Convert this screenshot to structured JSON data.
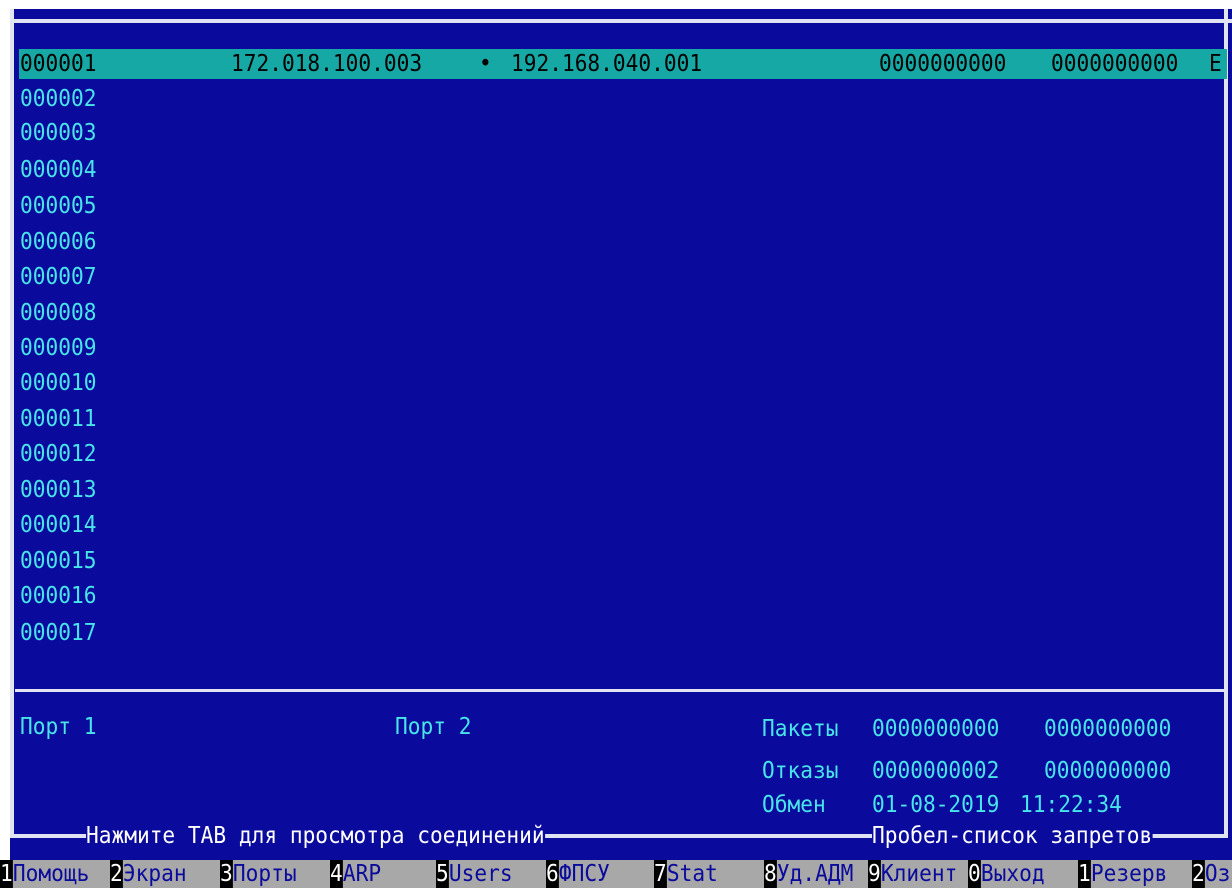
{
  "selected_row": {
    "id": "000001",
    "src_ip": "172.018.100.003",
    "arrow": "•",
    "dst_ip": "192.168.040.001",
    "count1": "0000000000",
    "count2": "0000000000",
    "flag": "E"
  },
  "rows": [
    "000002",
    "000003",
    "000004",
    "000005",
    "000006",
    "000007",
    "000008",
    "000009",
    "000010",
    "000011",
    "000012",
    "000013",
    "000014",
    "000015",
    "000016",
    "000017"
  ],
  "status": {
    "port1_label": "Порт 1",
    "port2_label": "Порт 2",
    "packets_label": "Пакеты",
    "packets_1": "0000000000",
    "packets_2": "0000000000",
    "failures_label": "Отказы",
    "failures_1": "0000000002",
    "failures_2": "0000000000",
    "exchange_label": "Обмен",
    "exchange_date": "01-08-2019",
    "exchange_time": "11:22:34"
  },
  "hints": {
    "left": "Нажмите TAB для просмотра соединений",
    "right": "Пробел-список запретов"
  },
  "fkeys": [
    {
      "num": "1",
      "label": "Помощь"
    },
    {
      "num": "2",
      "label": "Экран"
    },
    {
      "num": "3",
      "label": "Порты"
    },
    {
      "num": "4",
      "label": "ARP"
    },
    {
      "num": "5",
      "label": "Users"
    },
    {
      "num": "6",
      "label": "ФПСУ"
    },
    {
      "num": "7",
      "label": "Stat"
    },
    {
      "num": "8",
      "label": "Уд.АДМ"
    },
    {
      "num": "9",
      "label": "Клиент"
    },
    {
      "num": "0",
      "label": "Выход"
    },
    {
      "num": "1",
      "label": "Резерв"
    },
    {
      "num": "2",
      "label": "Оз"
    }
  ],
  "colors": {
    "background": "#0a0a9c",
    "text": "#48e4ea",
    "selection": "#15a8a4",
    "border": "#dfe3f2",
    "fkey_bar": "#a8a8a8"
  }
}
